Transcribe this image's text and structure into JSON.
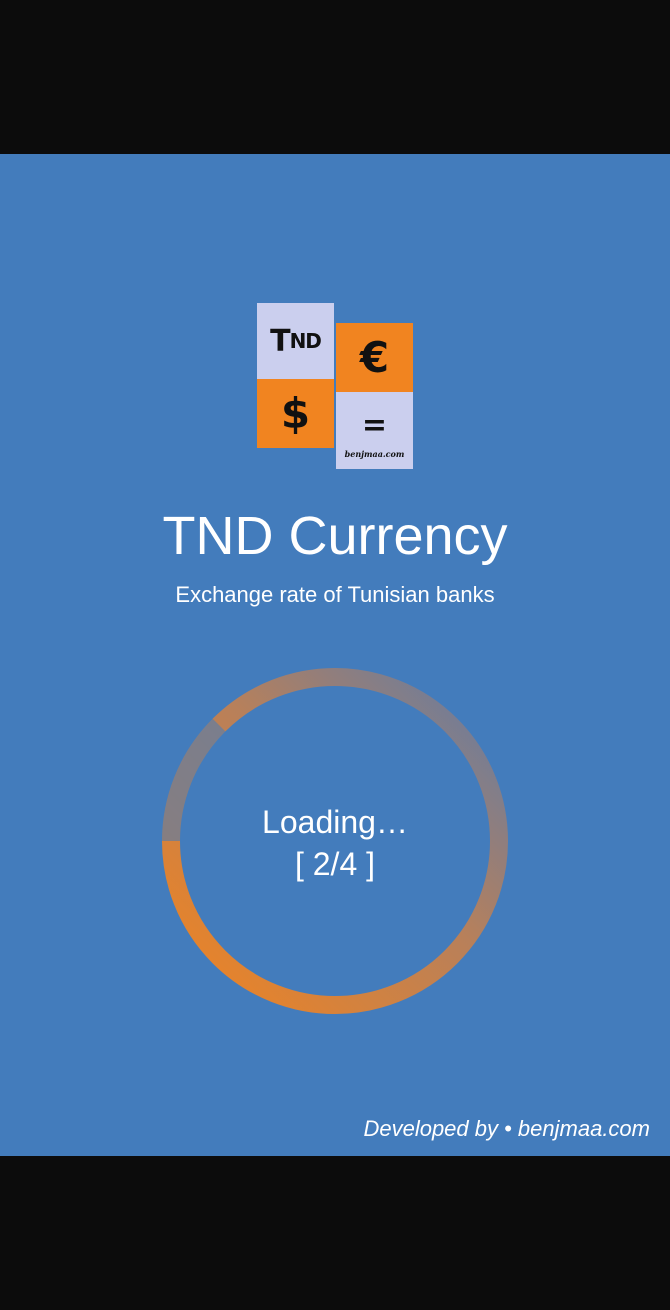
{
  "app": {
    "title": "TND Currency",
    "subtitle": "Exchange rate of Tunisian banks"
  },
  "logo": {
    "tnd_big": "T",
    "tnd_small": "ND",
    "usd_symbol": "$",
    "eur_symbol": "€",
    "equals_symbol": "=",
    "brand_text": "benjmaa.com"
  },
  "loader": {
    "label": "Loading…",
    "step": "[ 2/4 ]",
    "progress_fraction": 0.5
  },
  "footer": {
    "credit": "Developed by • benjmaa.com"
  },
  "colors": {
    "background": "#437cbc",
    "accent_orange": "#f18420",
    "tile_light": "#cbcfee",
    "system_bars": "#0c0c0c"
  }
}
